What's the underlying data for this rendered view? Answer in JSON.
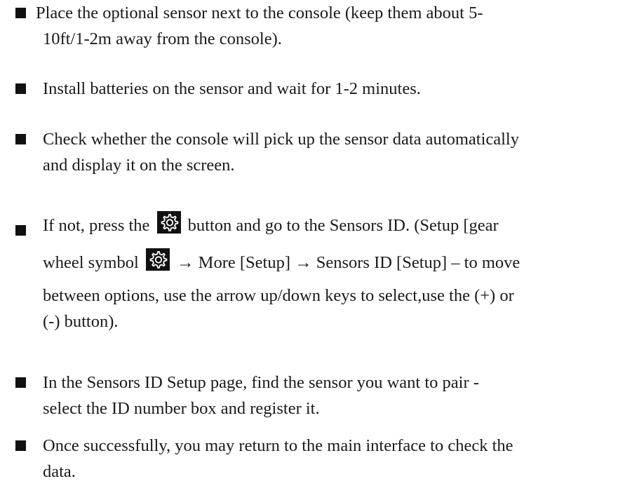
{
  "instructions": {
    "items": [
      {
        "lines": [
          "Place the optional sensor next to the console (keep them about 5-",
          "10ft/1-2m away from the console)."
        ]
      },
      {
        "lines": [
          "Install batteries on the sensor and wait for 1-2 minutes."
        ]
      },
      {
        "lines": [
          "Check whether the console will pick up the sensor data automatically",
          "and display it on the screen."
        ]
      },
      {
        "line1_before_icon": "If not, press the",
        "line1_after_icon": "button and go to the Sensors ID. (Setup [gear",
        "line2_before_icon": "wheel symbol",
        "line2_after_icon": "→ More [Setup] → Sensors ID [Setup] – to move",
        "lines_rest": [
          "between options, use the arrow up/down keys to select,use the (+) or",
          "(-) button)."
        ],
        "icon": "gear-icon"
      },
      {
        "lines": [
          "In the Sensors ID Setup page, find the sensor you want to pair -",
          "select the ID number box and register it."
        ]
      },
      {
        "lines": [
          "Once successfully, you may return to the main interface to check the",
          "data."
        ]
      }
    ]
  }
}
